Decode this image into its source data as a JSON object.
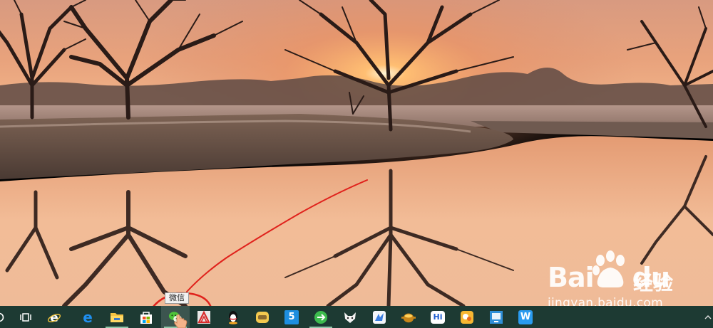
{
  "tooltip": {
    "text": "微信"
  },
  "watermark": {
    "brand_left": "Bai",
    "brand_right": "du",
    "brand_cn": "经验",
    "url": "jingyan.baidu.com"
  },
  "taskbar": {
    "buttons": [
      {
        "id": "search",
        "icon": "search-circle-icon"
      },
      {
        "id": "task-view",
        "icon": "task-view-icon"
      },
      {
        "id": "ie",
        "icon": "internet-explorer-icon"
      },
      {
        "id": "edge",
        "icon": "edge-icon"
      },
      {
        "id": "file-explorer",
        "icon": "folder-icon"
      },
      {
        "id": "store",
        "icon": "store-bag-icon"
      },
      {
        "id": "wechat",
        "icon": "wechat-icon",
        "label": "微信"
      },
      {
        "id": "app-red",
        "icon": "red-app-icon"
      },
      {
        "id": "qq",
        "icon": "qq-penguin-icon"
      },
      {
        "id": "app-yellow",
        "icon": "yellow-app-icon"
      },
      {
        "id": "app-5",
        "icon": "app-5-icon",
        "label": "5"
      },
      {
        "id": "app-green",
        "icon": "green-circle-icon"
      },
      {
        "id": "app-fox",
        "icon": "fox-icon"
      },
      {
        "id": "app-bird",
        "icon": "bird-icon"
      },
      {
        "id": "app-pot",
        "icon": "pot-icon"
      },
      {
        "id": "app-hi",
        "icon": "hi-chat-icon",
        "label": "Hi"
      },
      {
        "id": "app-orange",
        "icon": "orange-app-icon"
      },
      {
        "id": "app-screen",
        "icon": "screen-icon"
      },
      {
        "id": "app-w",
        "icon": "w-app-icon",
        "label": "W"
      }
    ],
    "colors": {
      "bar": "#1d3a33",
      "indicator": "#8fc7a9"
    }
  },
  "annotation": {
    "color": "#e0221c"
  }
}
